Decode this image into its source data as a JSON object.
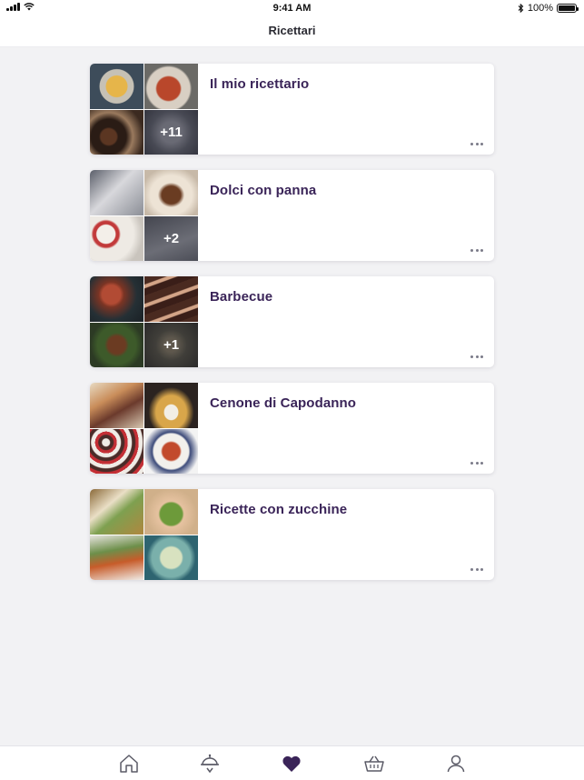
{
  "status_bar": {
    "time": "9:41 AM",
    "battery": "100%"
  },
  "header": {
    "title": "Ricettari"
  },
  "cookbooks": [
    {
      "title": "Il mio ricettario",
      "more_count": "+11"
    },
    {
      "title": "Dolci con panna",
      "more_count": "+2"
    },
    {
      "title": "Barbecue",
      "more_count": "+1"
    },
    {
      "title": "Cenone di Capodanno",
      "more_count": ""
    },
    {
      "title": "Ricette con zucchine",
      "more_count": ""
    }
  ],
  "tab_bar": {
    "items": [
      {
        "icon": "home-icon",
        "active": false
      },
      {
        "icon": "chef-hat-icon",
        "active": false
      },
      {
        "icon": "heart-icon",
        "active": true
      },
      {
        "icon": "basket-icon",
        "active": false
      },
      {
        "icon": "profile-icon",
        "active": false
      }
    ],
    "active_color": "#3a2458",
    "inactive_color": "#5a5a66"
  }
}
